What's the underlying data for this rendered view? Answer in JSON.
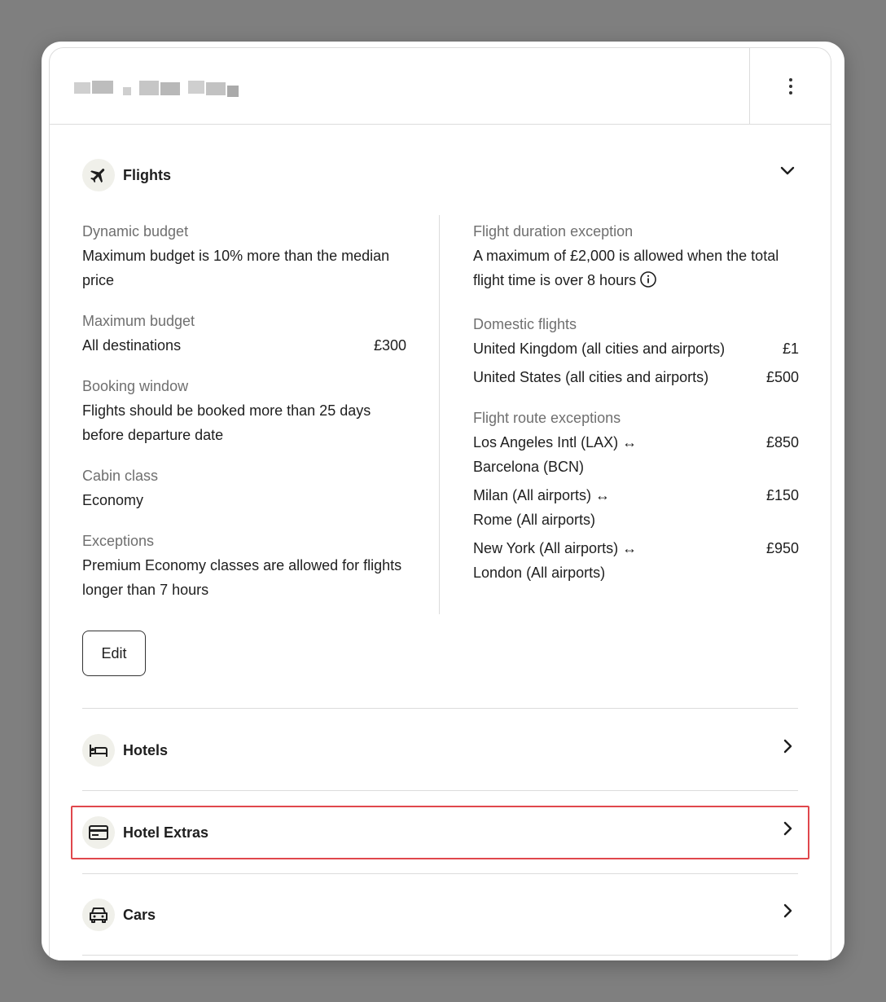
{
  "flights": {
    "title": "Flights",
    "dynamic_budget": {
      "label": "Dynamic budget",
      "value": "Maximum budget is 10% more than the median price"
    },
    "maximum_budget": {
      "label": "Maximum budget",
      "destination": "All destinations",
      "amount": "£300"
    },
    "booking_window": {
      "label": "Booking window",
      "value": "Flights should be booked more than 25 days before departure date"
    },
    "cabin_class": {
      "label": "Cabin class",
      "value": "Economy"
    },
    "exceptions": {
      "label": "Exceptions",
      "value": "Premium Economy classes are allowed for flights longer than 7 hours"
    },
    "duration_exception": {
      "label": "Flight duration exception",
      "value": "A maximum of £2,000 is allowed when the total flight time is over 8 hours"
    },
    "domestic": {
      "label": "Domestic flights",
      "items": [
        {
          "name": "United Kingdom (all cities and airports)",
          "amount": "£1"
        },
        {
          "name": "United States (all cities and airports)",
          "amount": "£500"
        }
      ]
    },
    "routes": {
      "label": "Flight route exceptions",
      "items": [
        {
          "from": "Los Angeles Intl  (LAX)",
          "to": "Barcelona  (BCN)",
          "amount": "£850"
        },
        {
          "from": "Milan  (All airports)",
          "to": "Rome  (All airports)",
          "amount": "£150"
        },
        {
          "from": "New York  (All airports)",
          "to": "London  (All airports)",
          "amount": "£950"
        }
      ]
    },
    "edit_label": "Edit"
  },
  "route_arrow": "↔",
  "sections": {
    "hotels": "Hotels",
    "hotel_extras": "Hotel Extras",
    "cars": "Cars"
  },
  "icons": {
    "menu": "more-vertical-icon",
    "flights": "airplane-icon",
    "hotels": "bed-icon",
    "hotel_extras": "card-icon",
    "cars": "car-icon"
  },
  "colors": {
    "highlight": "#e0474c",
    "icon_bg": "#f0f0ea"
  }
}
